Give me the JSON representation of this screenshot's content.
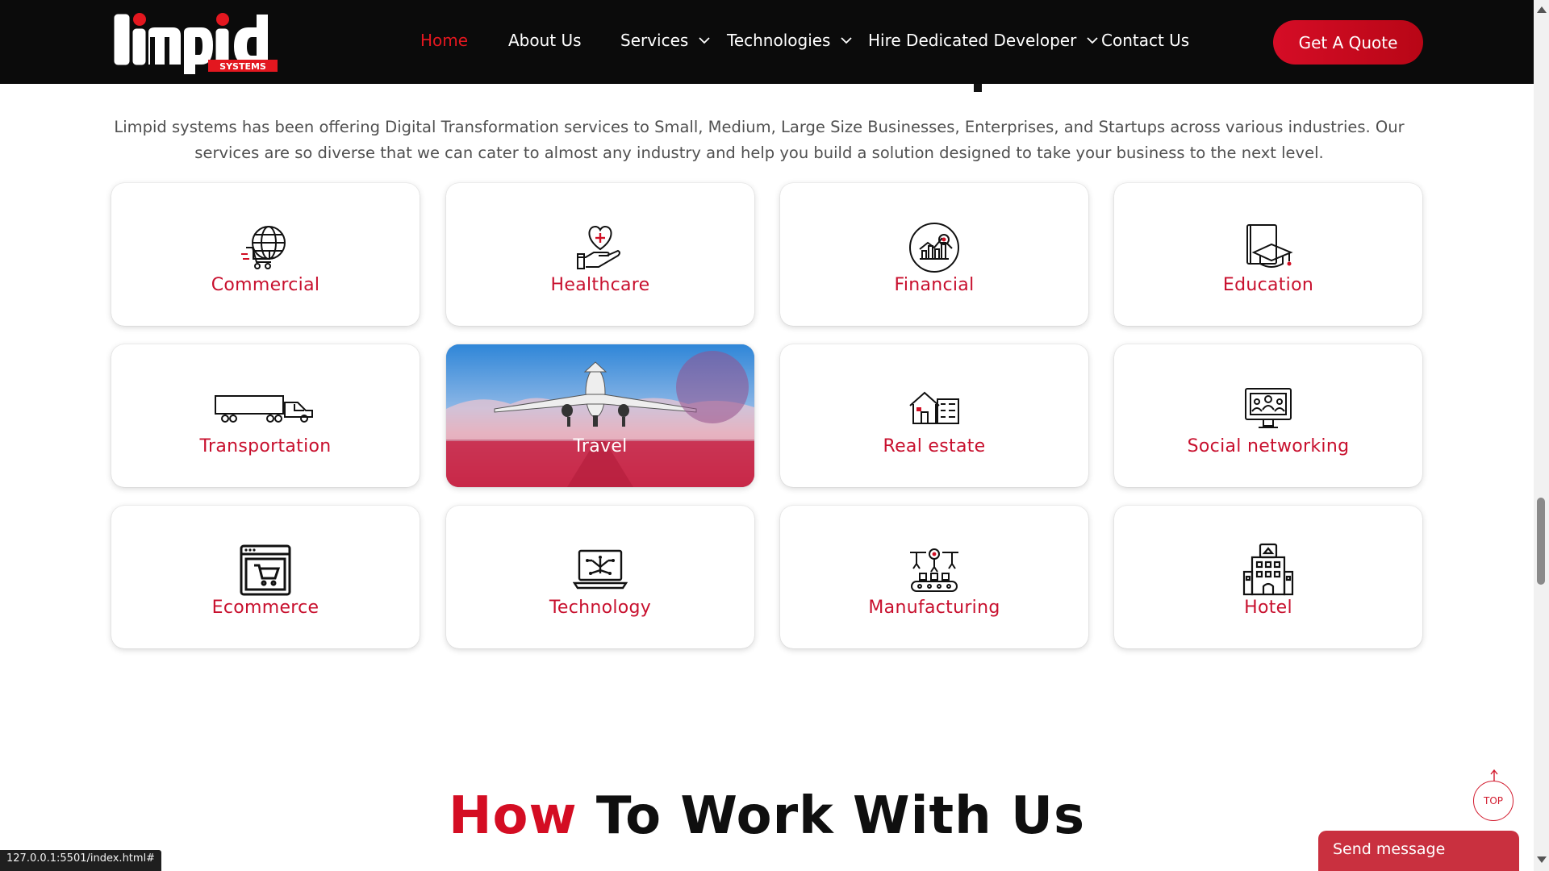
{
  "brand": {
    "name": "limpid",
    "tagline": "SYSTEMS",
    "accent": "#e3171f"
  },
  "nav": {
    "items": [
      {
        "label": "Home",
        "active": true,
        "dropdown": false
      },
      {
        "label": "About Us",
        "active": false,
        "dropdown": false
      },
      {
        "label": "Services",
        "active": false,
        "dropdown": true
      },
      {
        "label": "Technologies",
        "active": false,
        "dropdown": true
      },
      {
        "label": "Hire Dedicated Developer",
        "active": false,
        "dropdown": true
      },
      {
        "label": "Contact Us",
        "active": false,
        "dropdown": false
      }
    ],
    "cta": "Get A Quote"
  },
  "intro": {
    "text": "Limpid systems has been offering Digital Transformation services to Small, Medium, Large Size Businesses, Enterprises, and Startups across various industries. Our services are so diverse that we can cater to almost any industry and help you build a solution designed to take your business to the next level."
  },
  "industries": [
    {
      "label": "Commercial",
      "icon": "globe-cart-icon"
    },
    {
      "label": "Healthcare",
      "icon": "heart-hand-icon"
    },
    {
      "label": "Financial",
      "icon": "chart-magnifier-icon"
    },
    {
      "label": "Education",
      "icon": "book-graduation-cap-icon"
    },
    {
      "label": "Transportation",
      "icon": "truck-icon"
    },
    {
      "label": "Travel",
      "icon": "airplane-image",
      "hovered": true
    },
    {
      "label": "Real estate",
      "icon": "house-building-icon"
    },
    {
      "label": "Social networking",
      "icon": "monitor-people-icon"
    },
    {
      "label": "Ecommerce",
      "icon": "browser-cart-icon"
    },
    {
      "label": "Technology",
      "icon": "laptop-circuit-icon"
    },
    {
      "label": "Manufacturing",
      "icon": "robotic-arms-conveyor-icon"
    },
    {
      "label": "Hotel",
      "icon": "hotel-building-icon"
    }
  ],
  "how_section": {
    "accent_word": "How",
    "rest": "To Work With Us"
  },
  "widgets": {
    "top_button": "TOP",
    "send_message": "Send message",
    "status_url": "127.0.0.1:5501/index.html#"
  },
  "colors": {
    "header_bg": "#0b0b0b",
    "label_red": "#c8102e",
    "cta_red": "#d50d26"
  }
}
